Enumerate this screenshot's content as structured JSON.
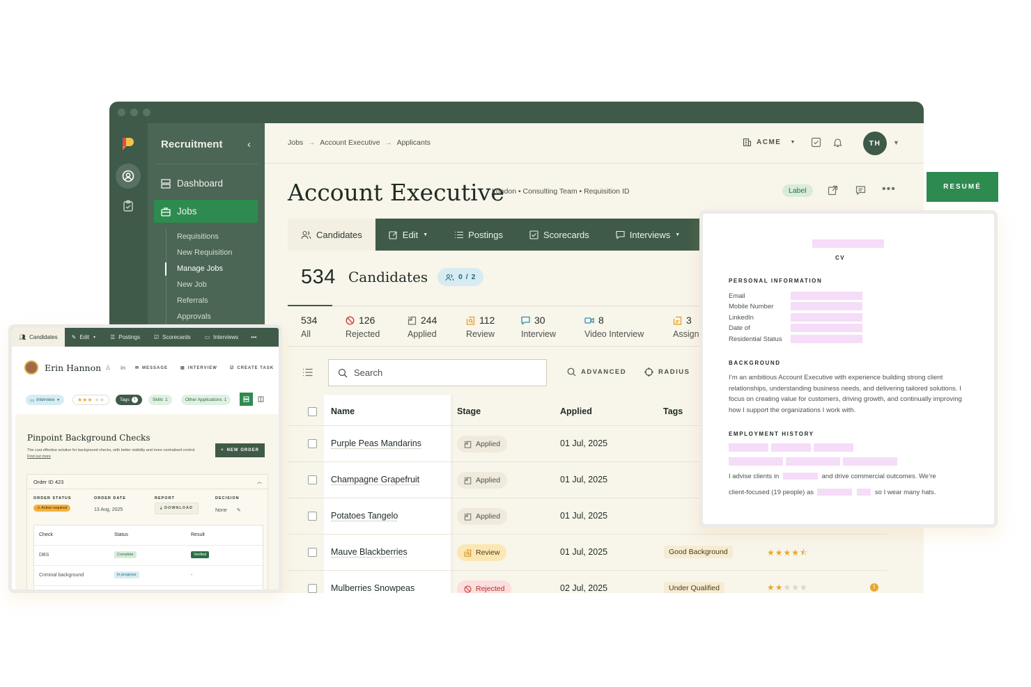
{
  "sidebar": {
    "title": "Recruitment",
    "items": [
      {
        "label": "Dashboard"
      },
      {
        "label": "Jobs"
      }
    ],
    "sub_items": [
      {
        "label": "Requisitions"
      },
      {
        "label": "New Requisition"
      },
      {
        "label": "Manage Jobs"
      },
      {
        "label": "New Job"
      },
      {
        "label": "Referrals"
      },
      {
        "label": "Approvals"
      }
    ]
  },
  "breadcrumb": [
    "Jobs",
    "Account Executive",
    "Applicants"
  ],
  "org_label": "ACME",
  "avatar_initials": "TH",
  "job": {
    "title": "Account Executive",
    "meta": "London • Consulting Team • Requisition ID",
    "label": "Label"
  },
  "tabs": [
    {
      "label": "Candidates"
    },
    {
      "label": "Edit"
    },
    {
      "label": "Postings"
    },
    {
      "label": "Scorecards"
    },
    {
      "label": "Interviews"
    }
  ],
  "candidates_count": "534",
  "candidates_label": "Candidates",
  "team_counter": "0 / 2",
  "stages": [
    {
      "count": "534",
      "label": "All"
    },
    {
      "count": "126",
      "label": "Rejected"
    },
    {
      "count": "244",
      "label": "Applied"
    },
    {
      "count": "112",
      "label": "Review"
    },
    {
      "count": "30",
      "label": "Interview"
    },
    {
      "count": "8",
      "label": "Video Interview"
    },
    {
      "count": "3",
      "label": "Assignm"
    }
  ],
  "search": {
    "placeholder": "Search"
  },
  "filters": {
    "advanced": "ADVANCED",
    "radius": "RADIUS"
  },
  "table": {
    "headers": {
      "name": "Name",
      "stage": "Stage",
      "applied": "Applied",
      "tags": "Tags"
    },
    "rows": [
      {
        "name": "Purple Peas Mandarins",
        "stage": "Applied",
        "applied": "01 Jul, 2025",
        "tag": "",
        "rating": 0
      },
      {
        "name": "Champagne Grapefruit",
        "stage": "Applied",
        "applied": "01 Jul, 2025",
        "tag": "",
        "rating": 0
      },
      {
        "name": "Potatoes Tangelo",
        "stage": "Applied",
        "applied": "01 Jul, 2025",
        "tag": "",
        "rating": 0
      },
      {
        "name": "Mauve Blackberries",
        "stage": "Review",
        "applied": "01 Jul, 2025",
        "tag": "Good Background",
        "rating": 4.5
      },
      {
        "name": "Mulberries Snowpeas",
        "stage": "Rejected",
        "applied": "02 Jul, 2025",
        "tag": "Under Qualified",
        "rating": 2
      }
    ]
  },
  "resume_button": "RESUMÉ",
  "cv": {
    "title": "CV",
    "personal_heading": "PERSONAL INFORMATION",
    "fields": [
      "Email",
      "Mobile Number",
      "LinkedIn",
      "Date of",
      "Residential Status"
    ],
    "background_heading": "BACKGROUND",
    "background_text": "I’m an ambitious Account Executive with experience building strong client relationships, understanding business needs, and delivering tailored solutions. I focus on creating value for customers, driving growth, and continually improving how I support the organizations I work with.",
    "employment_heading": "EMPLOYMENT HISTORY",
    "line1_a": "I advise clients in",
    "line1_b": "and drive commercial outcomes. We’re",
    "line2_a": "client-focused (19 people) as",
    "line2_b": "so I wear many hats."
  },
  "candidate_card": {
    "tabs": [
      {
        "label": "Candidates"
      },
      {
        "label": "Edit"
      },
      {
        "label": "Postings"
      },
      {
        "label": "Scorecards"
      },
      {
        "label": "Interviews"
      }
    ],
    "name": "Erin Hannon",
    "actions": {
      "message": "MESSAGE",
      "interview": "INTERVIEW",
      "create_task": "CREATE TASK"
    },
    "chips": {
      "interview": "Interview",
      "tags": "Tags",
      "tags_count": "1",
      "skills": "Skills",
      "skills_count": "1",
      "other": "Other Applications",
      "other_count": "1"
    },
    "rating": 3,
    "panel_title": "Pinpoint Background Checks",
    "panel_desc": "The cost effective solution for background checks, with better visibility and more centralised control.",
    "panel_link": "Find out more",
    "new_order": "NEW ORDER",
    "order_id": "Order ID 423",
    "order": {
      "status_h": "ORDER STATUS",
      "status_v": "Action required",
      "date_h": "ORDER DATE",
      "date_v": "13 Aug, 2025",
      "report_h": "REPORT",
      "report_v": "DOWNLOAD",
      "decision_h": "DECISION",
      "decision_v": "None"
    },
    "checks_headers": {
      "check": "Check",
      "status": "Status",
      "result": "Result"
    },
    "checks": [
      {
        "check": "DBS",
        "status": "Complete",
        "result": "Verified"
      },
      {
        "check": "Criminal background",
        "status": "In progress",
        "result": "-"
      }
    ]
  },
  "colors": {
    "brand_green": "#3f5a48",
    "accent_green": "#2e8b50",
    "cream": "#f8f5eb",
    "pink_redaction": "#f5dcf8",
    "star": "#e9a72d"
  }
}
